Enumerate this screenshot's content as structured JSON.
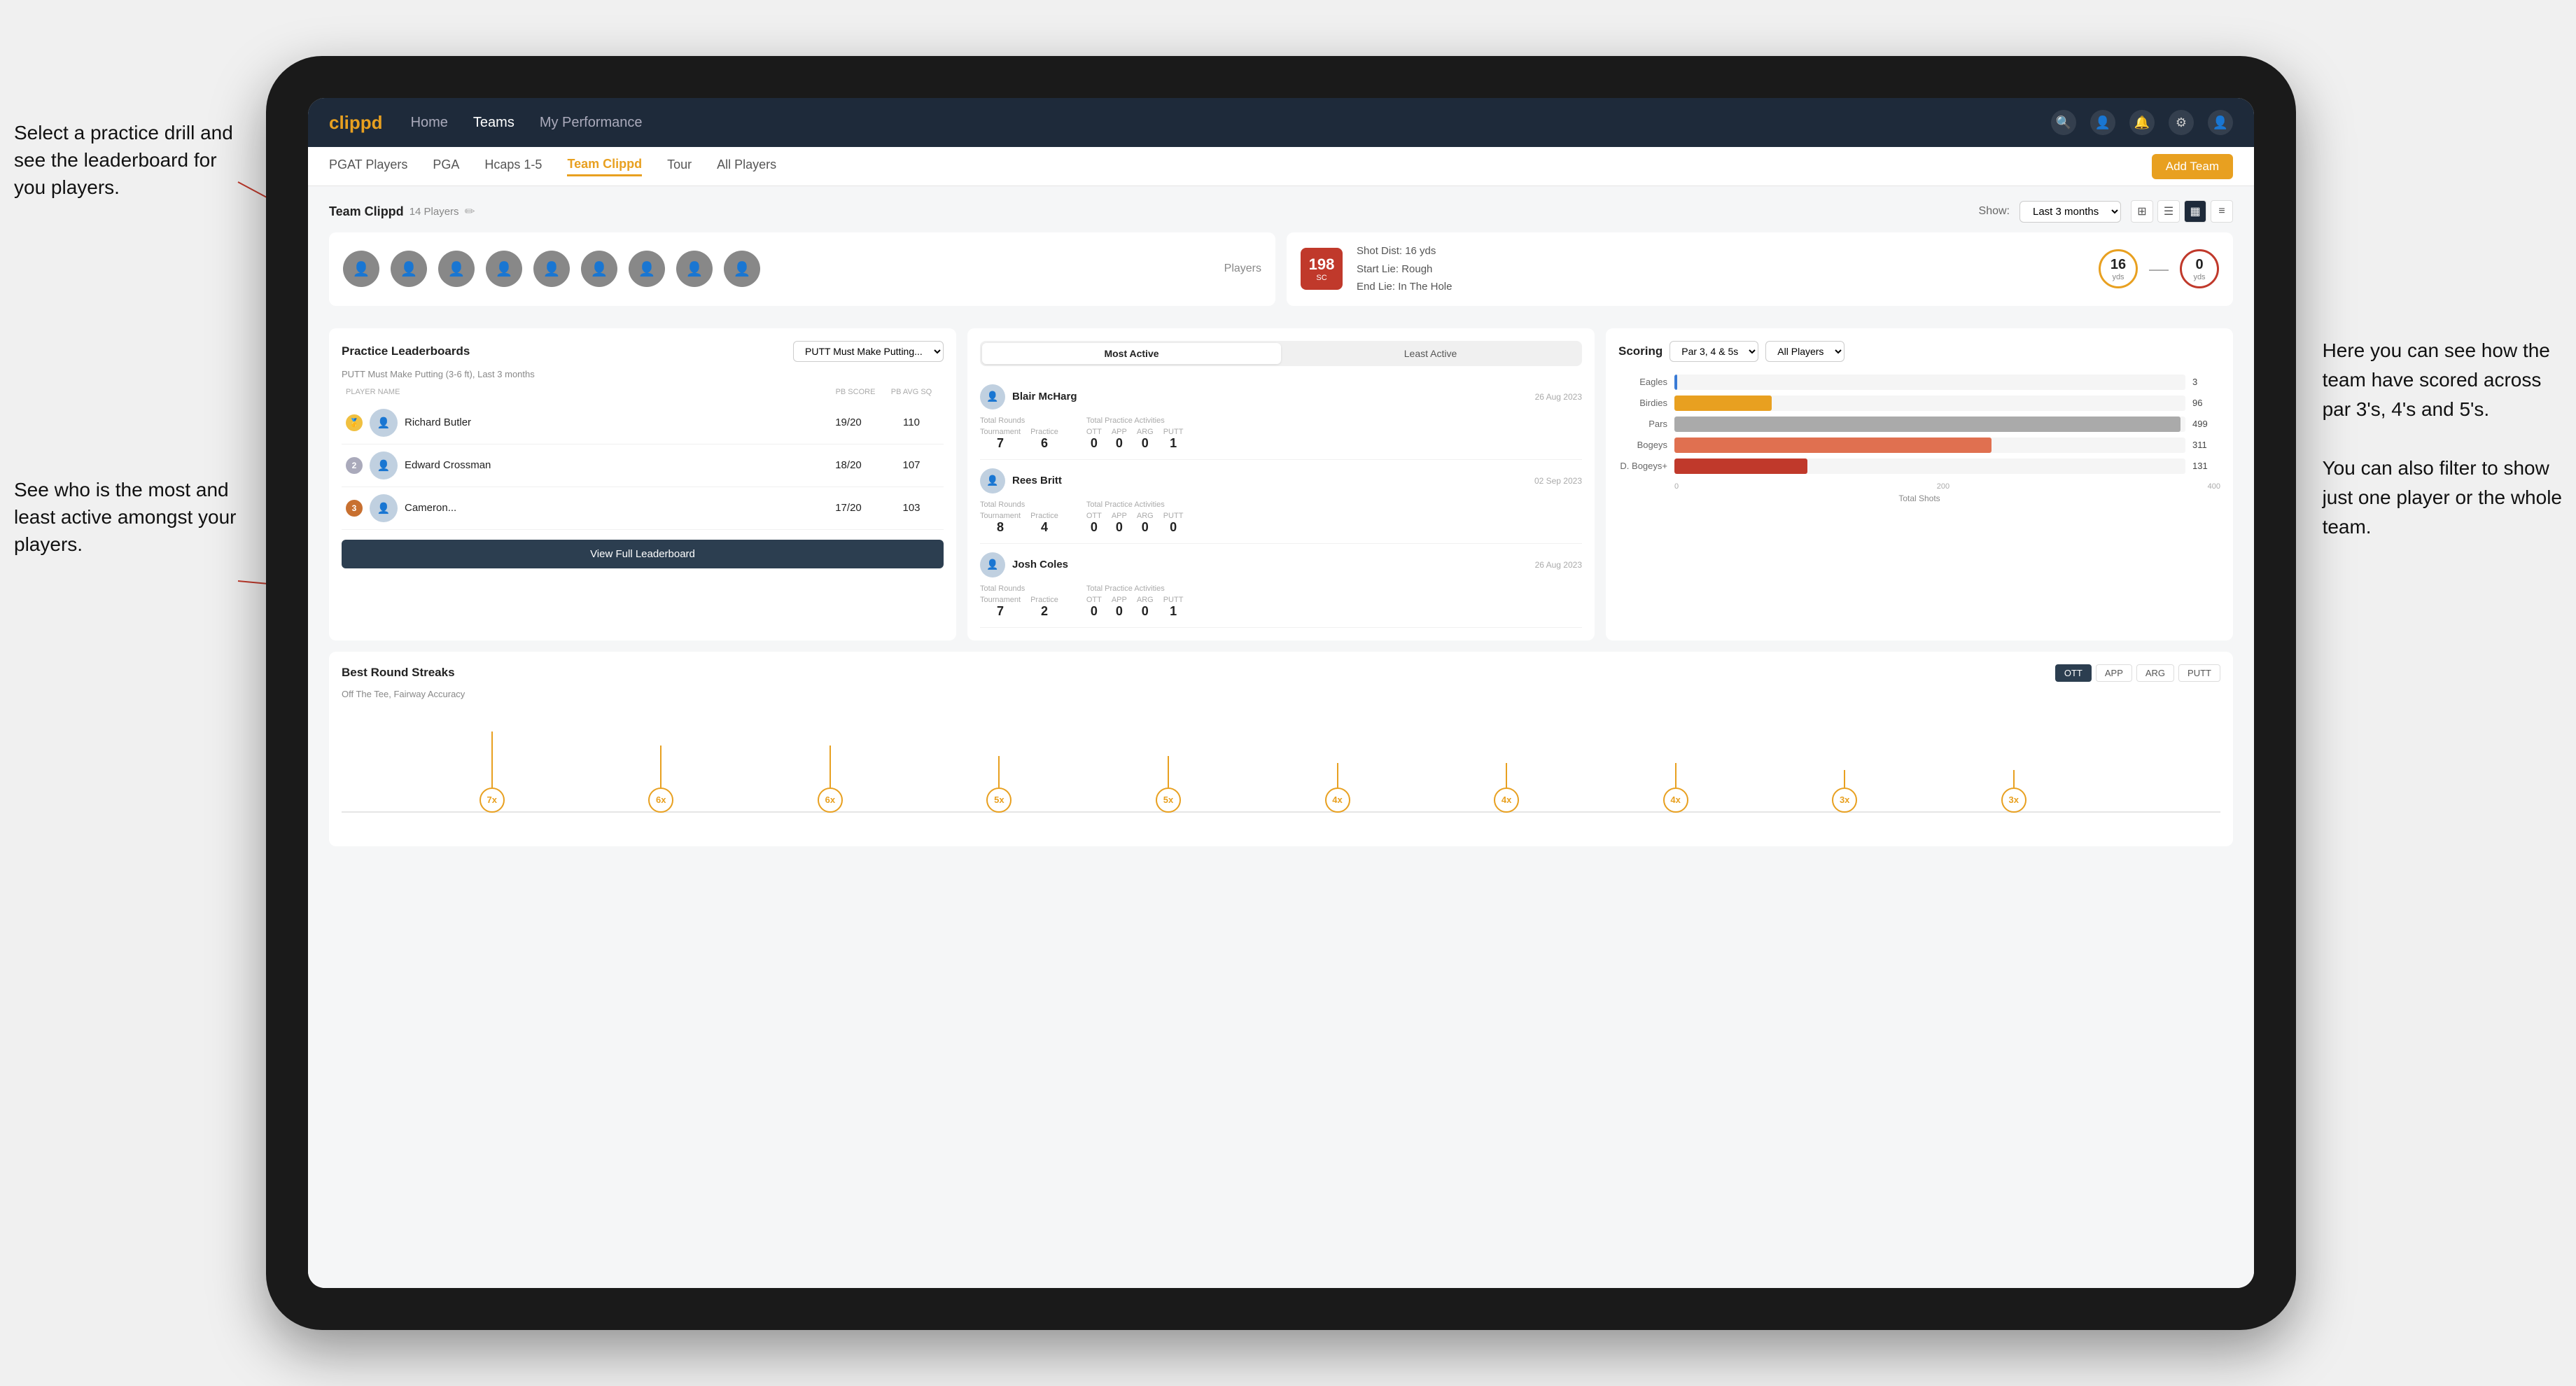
{
  "annotations": {
    "left_top": "Select a practice drill and see the leaderboard for you players.",
    "left_bottom": "See who is the most and least active amongst your players.",
    "right_top_line1": "Here you can see how the",
    "right_top_line2": "team have scored across",
    "right_top_line3": "par 3's, 4's and 5's.",
    "right_bottom_line1": "You can also filter to show",
    "right_bottom_line2": "just one player or the whole",
    "right_bottom_line3": "team."
  },
  "nav": {
    "logo": "clippd",
    "items": [
      "Home",
      "Teams",
      "My Performance"
    ],
    "active": "Teams"
  },
  "subnav": {
    "items": [
      "PGAT Players",
      "PGA",
      "Hcaps 1-5",
      "Team Clippd",
      "Tour",
      "All Players"
    ],
    "active": "Team Clippd",
    "add_btn": "Add Team"
  },
  "team": {
    "title": "Team Clippd",
    "count": "14 Players",
    "show_label": "Show:",
    "show_period": "Last 3 months"
  },
  "shot_info": {
    "badge_number": "198",
    "badge_sub": "SC",
    "line1": "Shot Dist: 16 yds",
    "line2": "Start Lie: Rough",
    "line3": "End Lie: In The Hole",
    "circle1_val": "16",
    "circle1_label": "yds",
    "circle2_val": "0",
    "circle2_label": "yds"
  },
  "leaderboard": {
    "panel_title": "Practice Leaderboards",
    "drill_select": "PUTT Must Make Putting...",
    "subtitle": "PUTT Must Make Putting (3-6 ft), Last 3 months",
    "col_player": "PLAYER NAME",
    "col_score": "PB SCORE",
    "col_avg": "PB AVG SQ",
    "players": [
      {
        "rank": 1,
        "rank_type": "gold",
        "name": "Richard Butler",
        "score": "19/20",
        "avg": "110",
        "medal": "🥇"
      },
      {
        "rank": 2,
        "rank_type": "silver",
        "name": "Edward Crossman",
        "score": "18/20",
        "avg": "107",
        "medal": "🥈"
      },
      {
        "rank": 3,
        "rank_type": "bronze",
        "name": "Cameron...",
        "score": "17/20",
        "avg": "103",
        "medal": "🥉"
      }
    ],
    "view_btn": "View Full Leaderboard"
  },
  "activity": {
    "tab_most": "Most Active",
    "tab_least": "Least Active",
    "active_tab": "Most Active",
    "players": [
      {
        "name": "Blair McHarg",
        "date": "26 Aug 2023",
        "total_rounds_label": "Total Rounds",
        "tournament": "7",
        "practice": "6",
        "total_practice_label": "Total Practice Activities",
        "ott": "0",
        "app": "0",
        "arg": "0",
        "putt": "1"
      },
      {
        "name": "Rees Britt",
        "date": "02 Sep 2023",
        "total_rounds_label": "Total Rounds",
        "tournament": "8",
        "practice": "4",
        "total_practice_label": "Total Practice Activities",
        "ott": "0",
        "app": "0",
        "arg": "0",
        "putt": "0"
      },
      {
        "name": "Josh Coles",
        "date": "26 Aug 2023",
        "total_rounds_label": "Total Rounds",
        "tournament": "7",
        "practice": "2",
        "total_practice_label": "Total Practice Activities",
        "ott": "0",
        "app": "0",
        "arg": "0",
        "putt": "1"
      }
    ]
  },
  "scoring": {
    "title": "Scoring",
    "filter1": "Par 3, 4 & 5s",
    "filter2": "All Players",
    "bars": [
      {
        "label": "Eagles",
        "value": 3,
        "max": 500,
        "color": "#3a7bd5"
      },
      {
        "label": "Birdies",
        "value": 96,
        "max": 500,
        "color": "#e8a020"
      },
      {
        "label": "Pars",
        "value": 499,
        "max": 500,
        "color": "#888"
      },
      {
        "label": "Bogeys",
        "value": 311,
        "max": 500,
        "color": "#e07050"
      },
      {
        "label": "D. Bogeys+",
        "value": 131,
        "max": 500,
        "color": "#c0392b"
      }
    ],
    "axis_labels": [
      "0",
      "200",
      "400"
    ],
    "axis_title": "Total Shots"
  },
  "streaks": {
    "title": "Best Round Streaks",
    "subtitle": "Off The Tee, Fairway Accuracy",
    "tabs": [
      "OTT",
      "APP",
      "ARG",
      "PUTT"
    ],
    "active_tab": "OTT",
    "points": [
      {
        "label": "7x",
        "left_pct": 8,
        "stem_h": 80
      },
      {
        "label": "6x",
        "left_pct": 17,
        "stem_h": 60
      },
      {
        "label": "6x",
        "left_pct": 26,
        "stem_h": 60
      },
      {
        "label": "5x",
        "left_pct": 35,
        "stem_h": 45
      },
      {
        "label": "5x",
        "left_pct": 44,
        "stem_h": 45
      },
      {
        "label": "4x",
        "left_pct": 53,
        "stem_h": 35
      },
      {
        "label": "4x",
        "left_pct": 62,
        "stem_h": 35
      },
      {
        "label": "4x",
        "left_pct": 71,
        "stem_h": 35
      },
      {
        "label": "3x",
        "left_pct": 80,
        "stem_h": 25
      },
      {
        "label": "3x",
        "left_pct": 89,
        "stem_h": 25
      }
    ]
  }
}
